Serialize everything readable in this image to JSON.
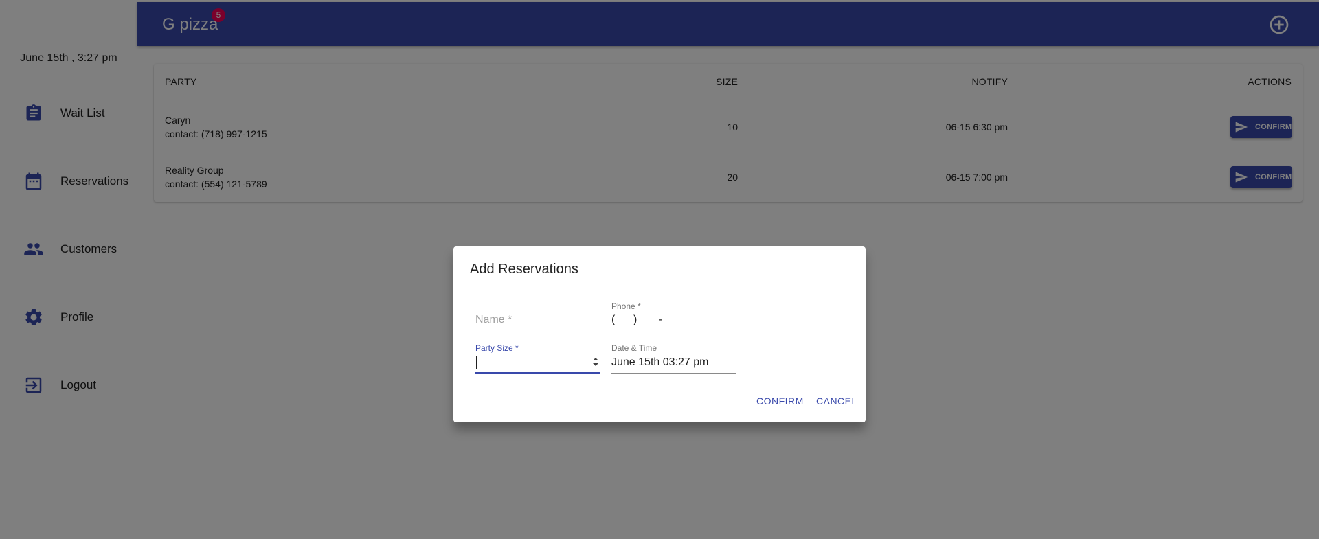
{
  "sidebar": {
    "datetime": "June 15th , 3:27 pm",
    "items": [
      {
        "label": "Wait List",
        "icon": "clipboard-icon"
      },
      {
        "label": "Reservations",
        "icon": "calendar-icon"
      },
      {
        "label": "Customers",
        "icon": "people-icon"
      },
      {
        "label": "Profile",
        "icon": "gear-icon"
      },
      {
        "label": "Logout",
        "icon": "logout-icon"
      }
    ]
  },
  "topbar": {
    "brand": "G pizza",
    "badge_count": "5",
    "add_icon": "add-circle-icon"
  },
  "table": {
    "headers": {
      "party": "PARTY",
      "size": "SIZE",
      "notify": "NOTIFY",
      "actions": "ACTIONS"
    },
    "rows": [
      {
        "name": "Caryn",
        "contact": "contact: (718) 997-1215",
        "size": "10",
        "notify": "06-15 6:30 pm",
        "action": "CONFIRM"
      },
      {
        "name": "Reality Group",
        "contact": "contact: (554) 121-5789",
        "size": "20",
        "notify": "06-15 7:00 pm",
        "action": "CONFIRM"
      }
    ]
  },
  "dialog": {
    "title": "Add Reservations",
    "name_placeholder": "Name *",
    "phone_label": "Phone *",
    "phone_value": "(      )       -",
    "party_size_label": "Party Size *",
    "party_size_value": "",
    "datetime_label": "Date & Time",
    "datetime_value": "June 15th 03:27 pm",
    "confirm": "CONFIRM",
    "cancel": "CANCEL"
  },
  "colors": {
    "primary": "#3949ab",
    "badge": "#f50057",
    "overlay": "rgba(0,0,0,0.5)"
  }
}
